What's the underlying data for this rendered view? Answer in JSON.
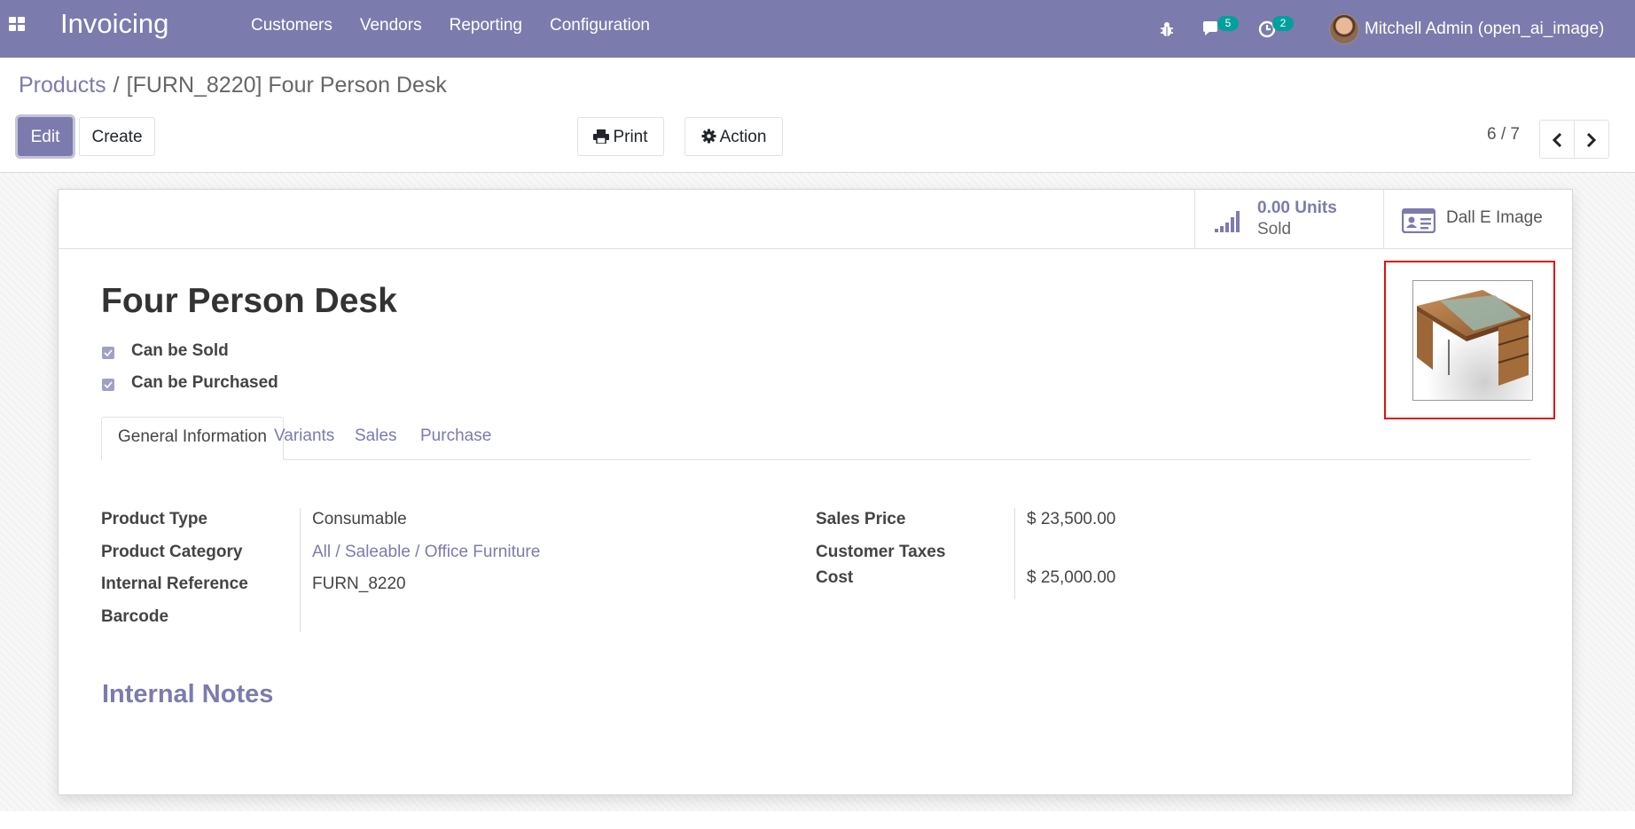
{
  "navbar": {
    "app_name": "Invoicing",
    "menu": [
      "Customers",
      "Vendors",
      "Reporting",
      "Configuration"
    ],
    "messages_count": "5",
    "activities_count": "2",
    "user_name": "Mitchell Admin (open_ai_image)",
    "icons": [
      "apps-menu-icon",
      "bug-icon",
      "chat-icon",
      "clock-icon"
    ]
  },
  "breadcrumb": {
    "parent": "Products",
    "separator": "/",
    "current": "[FURN_8220] Four Person Desk"
  },
  "toolbar": {
    "edit_label": "Edit",
    "create_label": "Create",
    "print_label": "Print",
    "action_label": "Action",
    "pager": "6 / 7"
  },
  "stat_buttons": {
    "sold_value": "0.00 Units",
    "sold_label": "Sold",
    "dalle_label": "Dall E Image"
  },
  "product": {
    "name": "Four Person Desk",
    "can_be_sold_label": "Can be Sold",
    "can_be_purchased_label": "Can be Purchased",
    "can_be_sold": true,
    "can_be_purchased": true
  },
  "tabs": [
    "General Information",
    "Variants",
    "Sales",
    "Purchase"
  ],
  "general_info": {
    "left": {
      "product_type_label": "Product Type",
      "product_type": "Consumable",
      "category_label": "Product Category",
      "category": "All / Saleable / Office Furniture",
      "internal_ref_label": "Internal Reference",
      "internal_ref": "FURN_8220",
      "barcode_label": "Barcode",
      "barcode": ""
    },
    "right": {
      "sales_price_label": "Sales Price",
      "sales_price": "$ 23,500.00",
      "customer_taxes_label": "Customer Taxes",
      "customer_taxes": "",
      "cost_label": "Cost",
      "cost": "$ 25,000.00"
    }
  },
  "internal_notes_title": "Internal Notes",
  "colors": {
    "brand": "#7c7bad",
    "badge": "#00a09d",
    "highlight_frame": "#e01010"
  }
}
